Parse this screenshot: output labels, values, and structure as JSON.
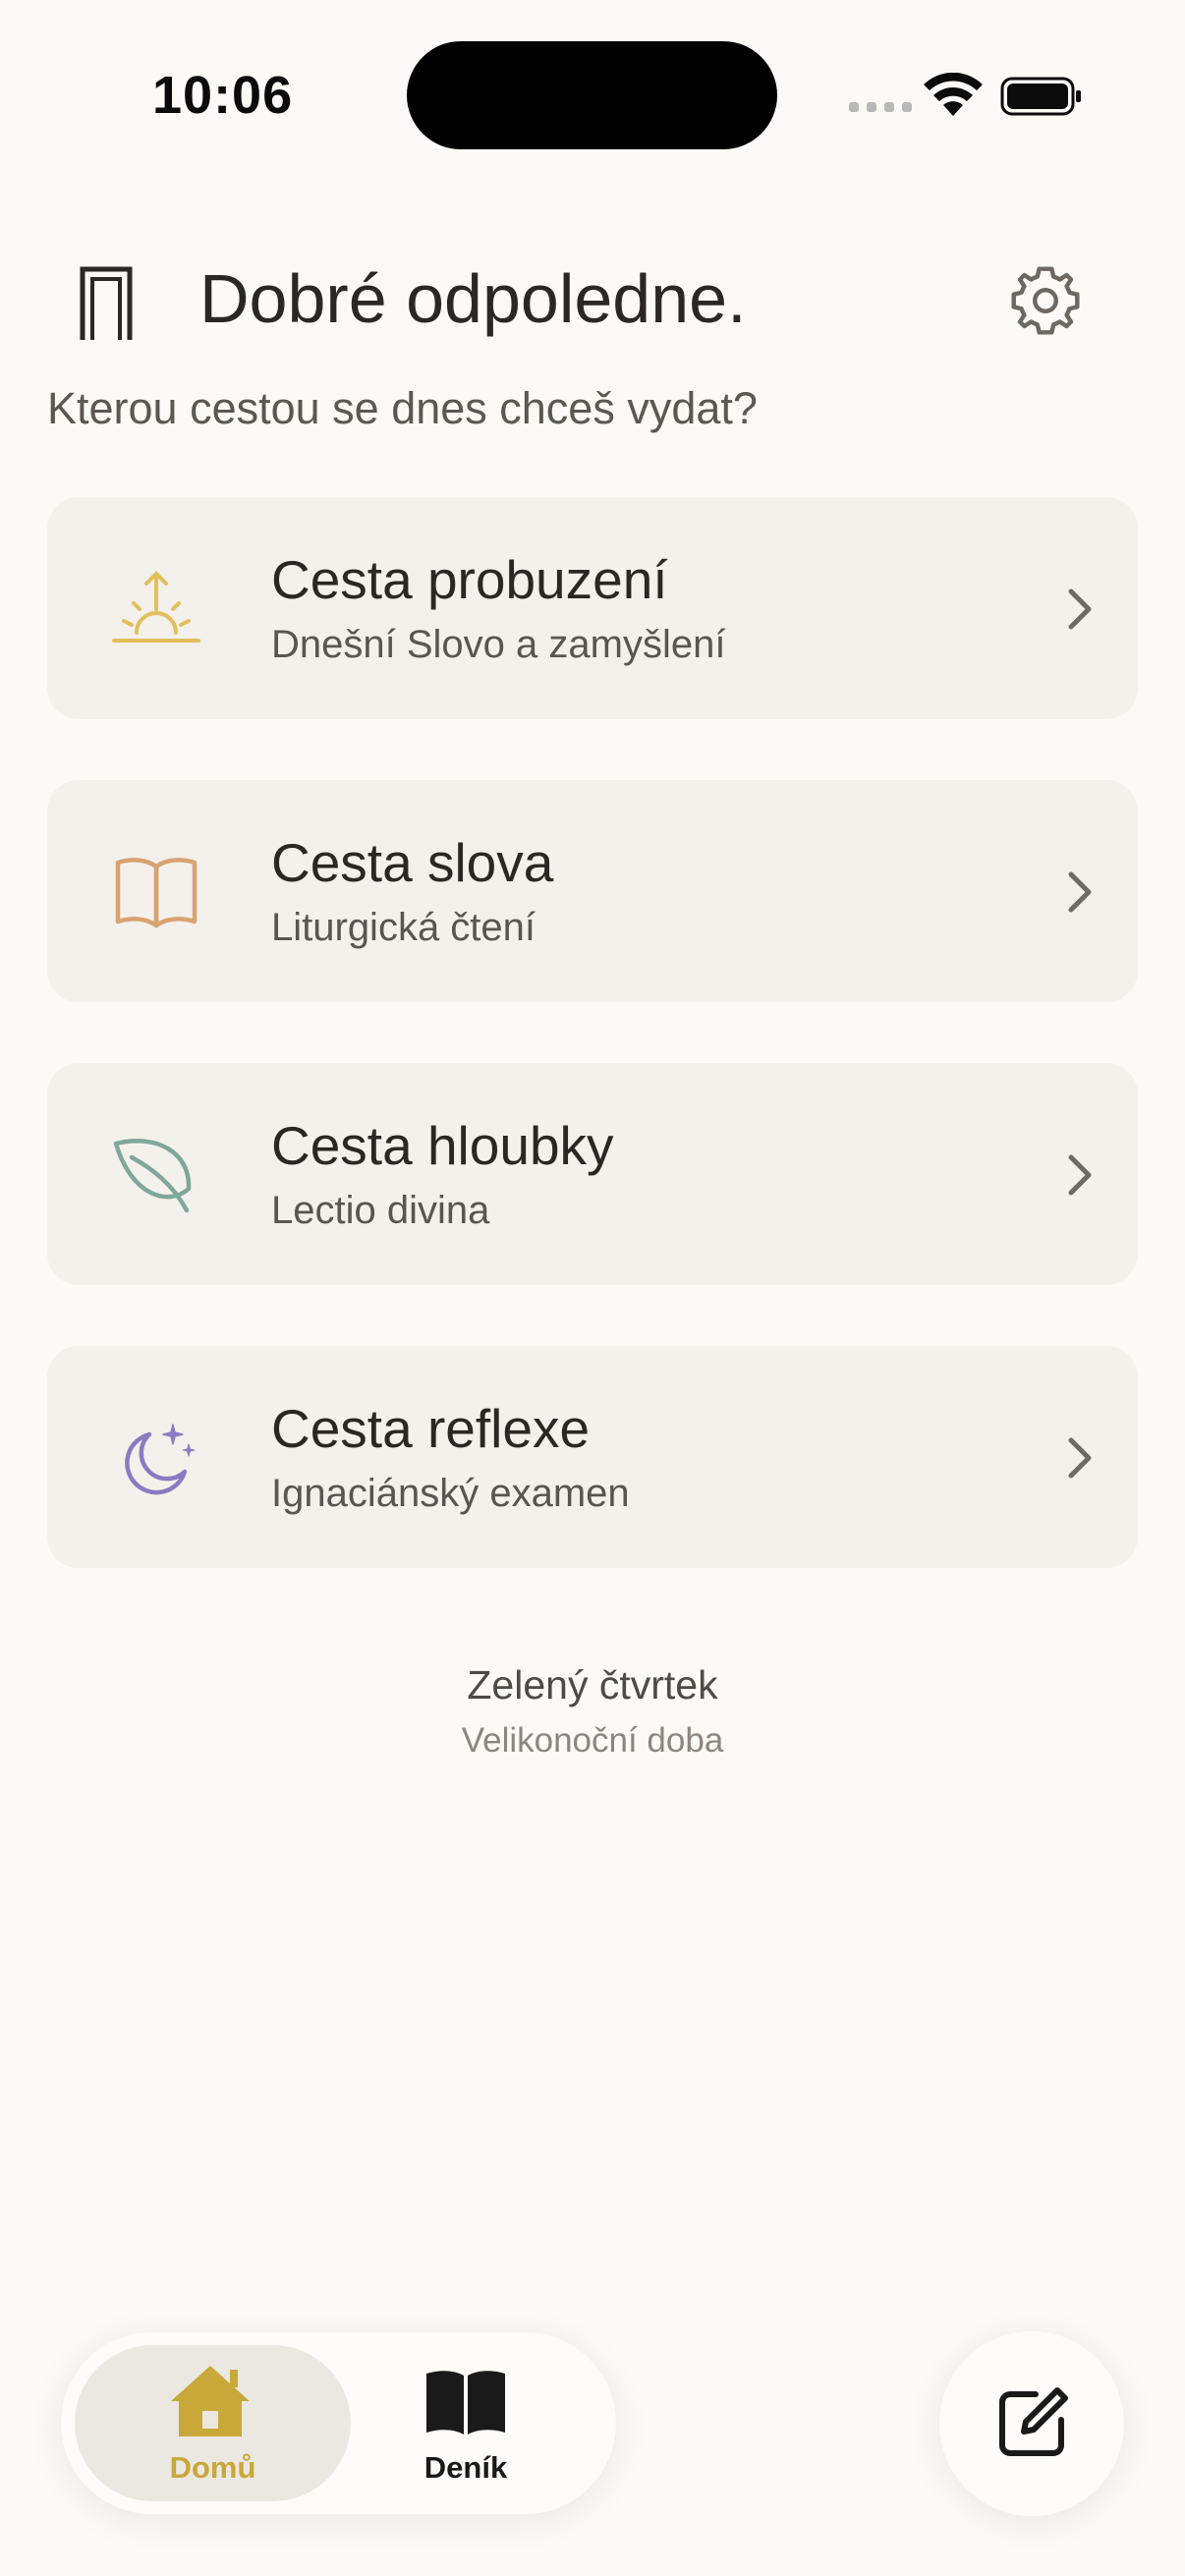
{
  "status_bar": {
    "time": "10:06"
  },
  "header": {
    "greeting": "Dobré odpoledne.",
    "question": "Kterou cestou se dnes chceš vydat?"
  },
  "paths": [
    {
      "title": "Cesta probuzení",
      "subtitle": "Dnešní Slovo a zamyšlení",
      "icon": "sunrise-icon",
      "color": "#e2bf5c"
    },
    {
      "title": "Cesta slova",
      "subtitle": "Liturgická čtení",
      "icon": "open-book-icon",
      "color": "#d9a271"
    },
    {
      "title": "Cesta hloubky",
      "subtitle": "Lectio divina",
      "icon": "leaf-icon",
      "color": "#7fa79b"
    },
    {
      "title": "Cesta reflexe",
      "subtitle": "Ignaciánský examen",
      "icon": "moon-stars-icon",
      "color": "#8b7bc2"
    }
  ],
  "liturgical_day": {
    "name": "Zelený čtvrtek",
    "season": "Velikonoční doba"
  },
  "tab_bar": {
    "home_label": "Domů",
    "journal_label": "Deník",
    "active_color": "#c9a83a"
  },
  "compose_button_icon": "compose-icon"
}
